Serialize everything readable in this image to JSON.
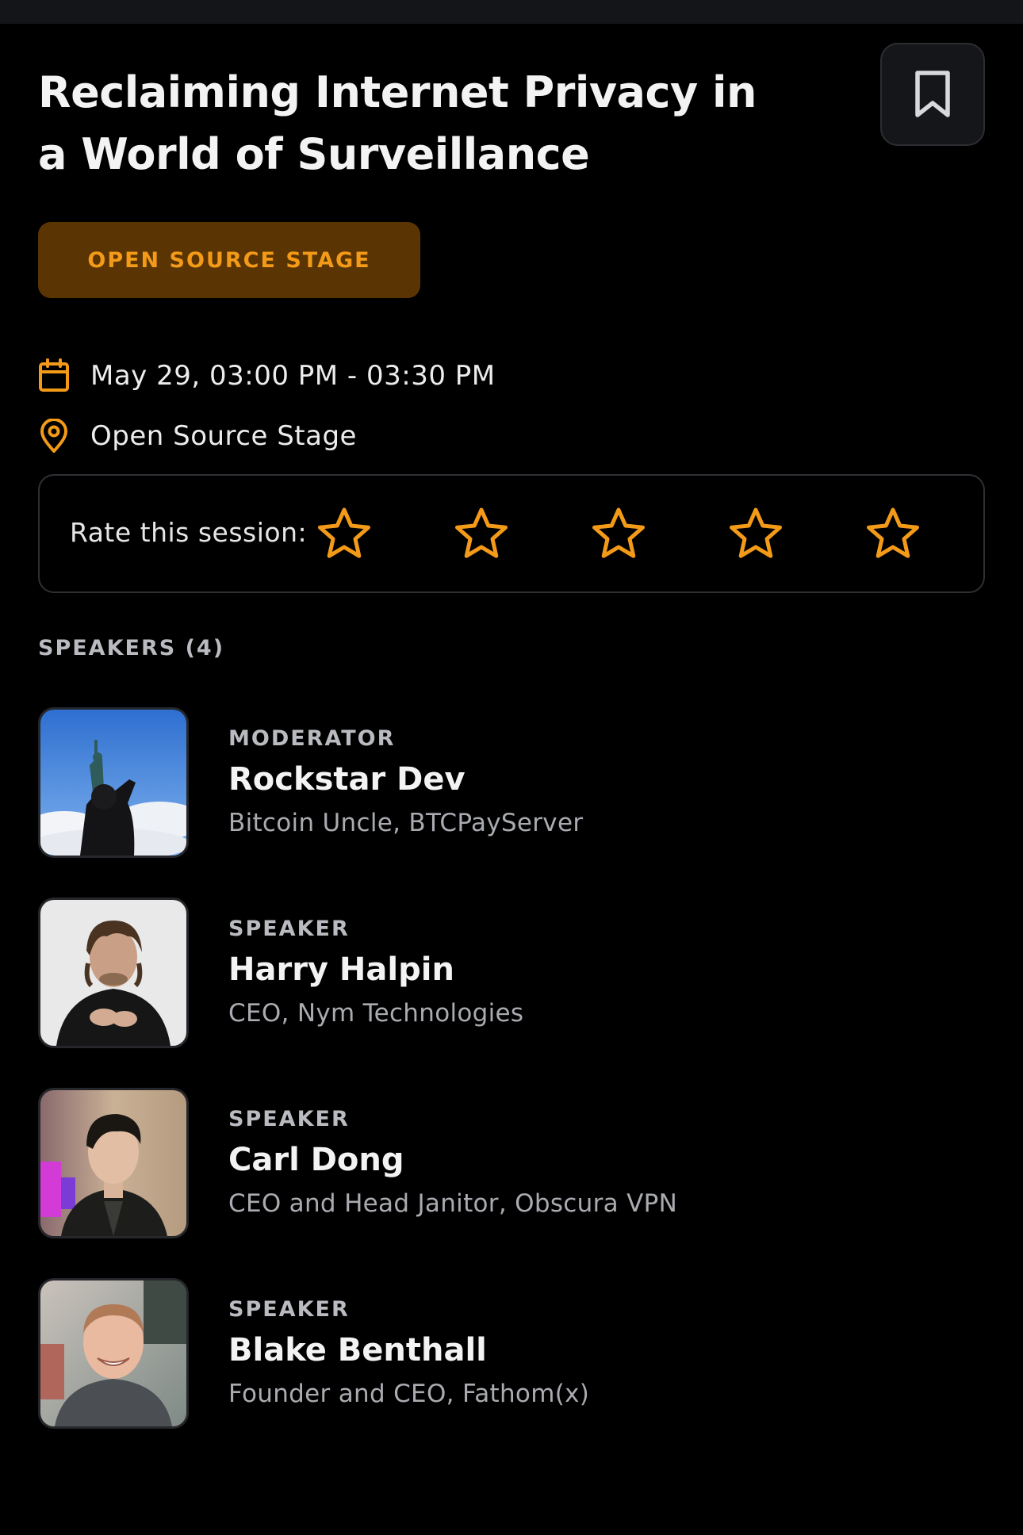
{
  "session": {
    "title": "Reclaiming Internet Privacy in a World of Surveillance",
    "track_badge": "OPEN SOURCE STAGE",
    "datetime": "May 29, 03:00 PM - 03:30 PM",
    "location": "Open Source Stage"
  },
  "icons": {
    "bookmark": "bookmark-icon",
    "date": "calendar-icon",
    "location": "map-pin-icon",
    "rating": "star-outline-icon"
  },
  "rating": {
    "label": "Rate this session:",
    "max_stars": 5,
    "selected": 0
  },
  "speakers": {
    "heading": "SPEAKERS (4)",
    "items": [
      {
        "role": "MODERATOR",
        "name": "Rockstar Dev",
        "org": "Bitcoin Uncle, BTCPayServer"
      },
      {
        "role": "SPEAKER",
        "name": "Harry Halpin",
        "org": "CEO, Nym Technologies"
      },
      {
        "role": "SPEAKER",
        "name": "Carl Dong",
        "org": "CEO and Head Janitor, Obscura VPN"
      },
      {
        "role": "SPEAKER",
        "name": "Blake Benthall",
        "org": "Founder and CEO, Fathom(x)"
      }
    ]
  },
  "colors": {
    "background": "#000000",
    "accent": "#f39a18",
    "badge_bg": "#5a3503",
    "muted_text": "#a9abb0"
  }
}
